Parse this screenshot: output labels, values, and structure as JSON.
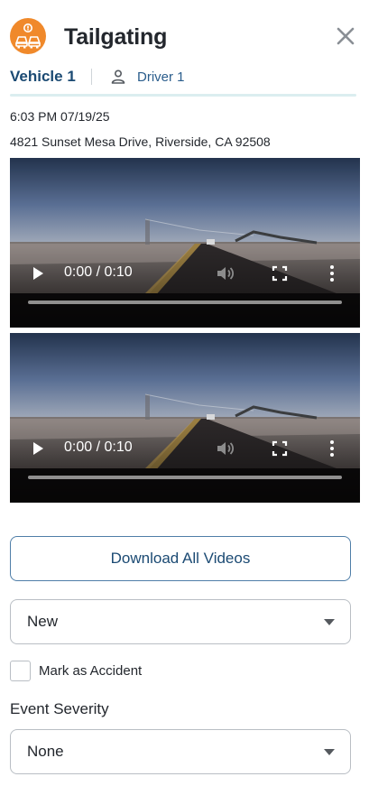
{
  "header": {
    "title": "Tailgating",
    "event_icon": "tailgating-cars-icon",
    "close_icon": "close-icon"
  },
  "tabs": {
    "vehicle": "Vehicle 1",
    "driver": "Driver 1",
    "driver_icon": "person-icon"
  },
  "event": {
    "timestamp": "6:03 PM 07/19/25",
    "address": "4821 Sunset Mesa Drive, Riverside, CA 92508"
  },
  "videos": [
    {
      "time": "0:00 / 0:10",
      "progress": 0
    },
    {
      "time": "0:00 / 0:10",
      "progress": 0
    }
  ],
  "actions": {
    "download_label": "Download All Videos"
  },
  "status": {
    "selected": "New"
  },
  "accident": {
    "label": "Mark as Accident",
    "checked": false
  },
  "severity": {
    "label": "Event Severity",
    "selected": "None"
  },
  "colors": {
    "accent": "#f0892b",
    "primary": "#1b4a73",
    "tab_underline": "#dbeef0"
  }
}
